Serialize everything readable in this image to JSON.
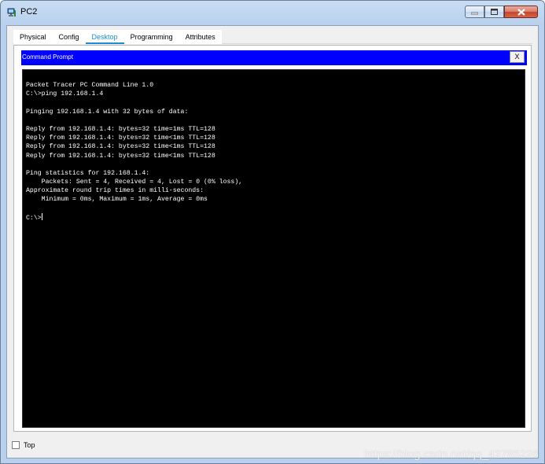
{
  "window": {
    "title": "PC2",
    "icon": "pc-icon",
    "controls": {
      "minimize_icon": "minimize-icon",
      "maximize_icon": "maximize-icon",
      "close_icon": "close-icon"
    }
  },
  "tabs": [
    {
      "label": "Physical"
    },
    {
      "label": "Config"
    },
    {
      "label": "Desktop"
    },
    {
      "label": "Programming"
    },
    {
      "label": "Attributes"
    }
  ],
  "active_tab": "Desktop",
  "command_prompt": {
    "title": "Command Prompt",
    "close_label": "X",
    "header_color": "#0000ff",
    "lines": [
      "Packet Tracer PC Command Line 1.0",
      "C:\\>ping 192.168.1.4",
      "",
      "Pinging 192.168.1.4 with 32 bytes of data:",
      "",
      "Reply from 192.168.1.4: bytes=32 time=1ms TTL=128",
      "Reply from 192.168.1.4: bytes=32 time<1ms TTL=128",
      "Reply from 192.168.1.4: bytes=32 time<1ms TTL=128",
      "Reply from 192.168.1.4: bytes=32 time<1ms TTL=128",
      "",
      "Ping statistics for 192.168.1.4:",
      "    Packets: Sent = 4, Received = 4, Lost = 0 (0% loss),",
      "Approximate round trip times in milli-seconds:",
      "    Minimum = 0ms, Maximum = 1ms, Average = 0ms",
      ""
    ],
    "prompt": "C:\\>"
  },
  "footer": {
    "top_label": "Top",
    "top_checked": false
  },
  "watermark": "https://blog.csdn.net/qq_42785226",
  "colors": {
    "accent": "#1a8ed0",
    "terminal_bg": "#000000",
    "terminal_fg": "#ffffff"
  }
}
